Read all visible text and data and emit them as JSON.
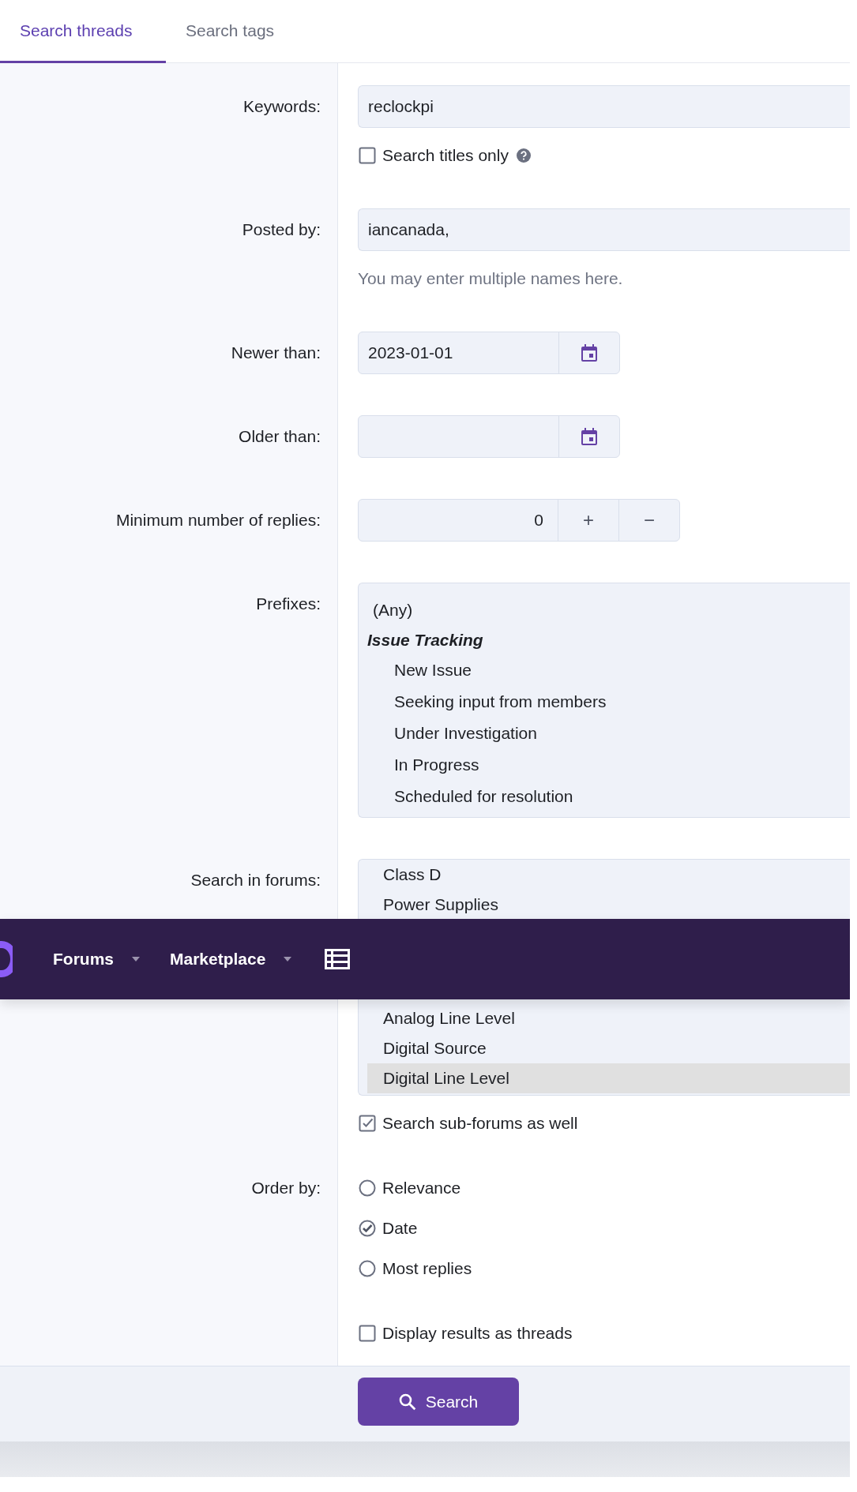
{
  "tabs": [
    {
      "label": "Search threads",
      "selected": true
    },
    {
      "label": "Search tags",
      "selected": false
    }
  ],
  "fields": [
    {
      "kind": "text",
      "label": "Keywords:",
      "value": "reclockpi",
      "checkbox": {
        "label": "Search titles only",
        "checked": false,
        "help": true
      }
    },
    {
      "kind": "text",
      "label": "Posted by:",
      "value": "iancanada,",
      "hint": "You may enter multiple names here."
    },
    {
      "kind": "date",
      "label": "Newer than:",
      "value": "2023-01-01"
    },
    {
      "kind": "date",
      "label": "Older than:"
    },
    {
      "kind": "number",
      "label": "Minimum number of replies:",
      "value": "0",
      "increment": "+",
      "decrement": "−"
    },
    {
      "kind": "prefixes",
      "label": "Prefixes:",
      "options": [
        {
          "kind": "option",
          "text": "(Any)"
        },
        {
          "kind": "group",
          "text": "Issue Tracking",
          "children": [
            {
              "text": "New Issue"
            },
            {
              "text": "Seeking input from members"
            },
            {
              "text": "Under Investigation"
            },
            {
              "text": "In Progress"
            },
            {
              "text": "Scheduled for resolution"
            }
          ]
        }
      ]
    },
    {
      "kind": "forums",
      "label": "Search in forums:",
      "options_top": [
        {
          "text": "Class D",
          "selected": false
        },
        {
          "text": "Power Supplies",
          "selected": false
        }
      ],
      "options_bottom": [
        {
          "text": "Analog Line Level",
          "selected": false
        },
        {
          "text": "Digital Source",
          "selected": false
        },
        {
          "text": "Digital Line Level",
          "selected": true
        }
      ],
      "checkbox": {
        "label": "Search sub-forums as well",
        "checked": true
      }
    },
    {
      "kind": "radio",
      "label": "Order by:",
      "options": [
        {
          "label": "Relevance",
          "selected": false
        },
        {
          "label": "Date",
          "selected": true
        },
        {
          "label": "Most replies",
          "selected": false
        }
      ]
    },
    {
      "kind": "check",
      "checkbox": {
        "label": "Display results as threads",
        "checked": false
      }
    }
  ],
  "submit": {
    "label": "Search"
  },
  "navbar": {
    "items": [
      {
        "label": "Forums",
        "dropdown": true
      },
      {
        "label": "Marketplace",
        "dropdown": true
      }
    ],
    "list_icon": true
  }
}
